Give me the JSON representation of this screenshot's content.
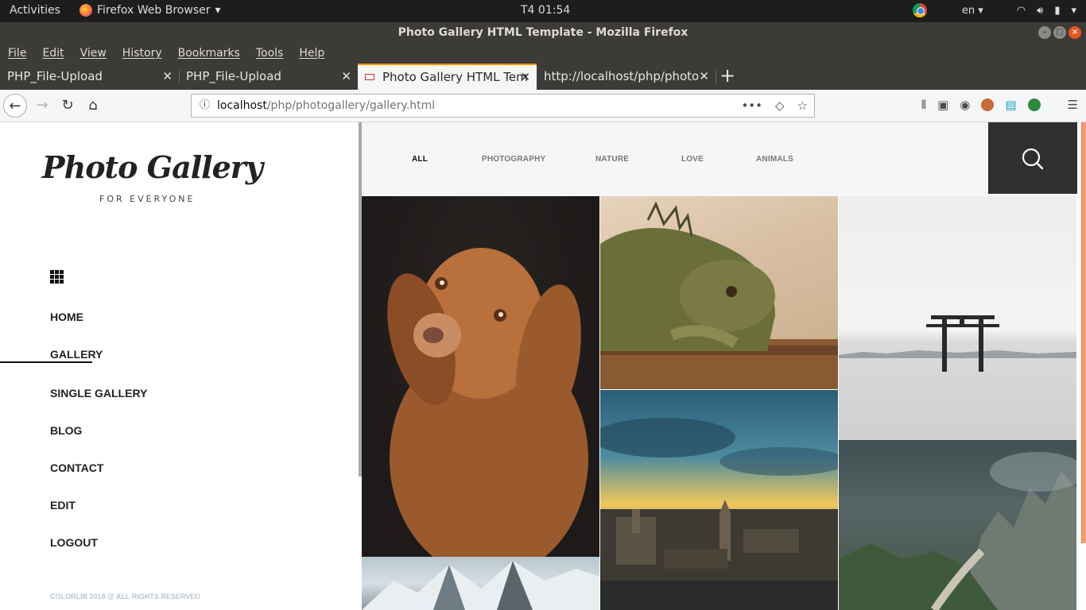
{
  "system_bar": {
    "activities": "Activities",
    "app_name": "Firefox Web Browser",
    "clock": "T4 01:54",
    "language": "en"
  },
  "window": {
    "title": "Photo Gallery HTML Template - Mozilla Firefox"
  },
  "menu": [
    "File",
    "Edit",
    "View",
    "History",
    "Bookmarks",
    "Tools",
    "Help"
  ],
  "tabs": [
    {
      "label": "PHP_File-Upload",
      "active": false
    },
    {
      "label": "PHP_File-Upload",
      "active": false
    },
    {
      "label": "Photo Gallery HTML Tem",
      "active": true
    },
    {
      "label": "http://localhost/php/photo",
      "active": false
    }
  ],
  "url": {
    "host": "localhost",
    "path": "/php/photogallery/gallery.html"
  },
  "site": {
    "logo": "Photo Gallery",
    "tagline": "FOR EVERYONE",
    "nav": [
      "HOME",
      "GALLERY",
      "SINGLE GALLERY",
      "BLOG",
      "CONTACT",
      "EDIT",
      "LOGOUT"
    ],
    "active_nav": "GALLERY",
    "copyright": "COLORLIB 2018 @ ALL RIGHTS RESERVED",
    "filters": [
      "ALL",
      "PHOTOGRAPHY",
      "NATURE",
      "LOVE",
      "ANIMALS"
    ],
    "active_filter": "ALL"
  },
  "colors": {
    "accent_tab": "#ff9400",
    "search_bg": "#2f2f2f",
    "filter_bg": "#f5f6f7"
  }
}
